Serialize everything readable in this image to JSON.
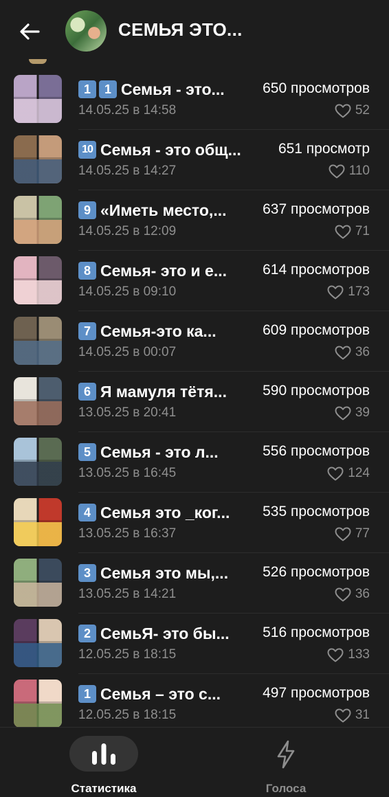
{
  "header": {
    "title": "СЕМЬЯ ЭТО...",
    "back_icon": "arrow-left-icon"
  },
  "posts": [
    {
      "badge": "1 1",
      "badges": [
        "1",
        "1"
      ],
      "title": "Семья - это...",
      "views": "650 просмотров",
      "date": "14.05.25 в 14:58",
      "likes": "52",
      "thumb": [
        "#b9a4c6",
        "#7a6e96",
        "#d8c5d9"
      ]
    },
    {
      "badges": [
        "10"
      ],
      "title": "Семья - это общ...",
      "views": "651 просмотр",
      "date": "14.05.25 в 14:27",
      "likes": "110",
      "thumb": [
        "#8a6b4e",
        "#c49b7a",
        "#3f5a7a"
      ]
    },
    {
      "badges": [
        "9"
      ],
      "title": "«Иметь место,...",
      "views": "637 просмотров",
      "date": "14.05.25 в 12:09",
      "likes": "71",
      "thumb": [
        "#c9c2a5",
        "#7ea374",
        "#d4a07a"
      ]
    },
    {
      "badges": [
        "8"
      ],
      "title": "Семья- это и е...",
      "views": "614 просмотров",
      "date": "14.05.25 в 09:10",
      "likes": "173",
      "thumb": [
        "#e2b4c0",
        "#6c5a6a",
        "#f1d6d8"
      ]
    },
    {
      "badges": [
        "7"
      ],
      "title": "Семья-это ка...",
      "views": "609 просмотров",
      "date": "14.05.25 в 00:07",
      "likes": "36",
      "thumb": [
        "#6e6150",
        "#9a8c74",
        "#4f6a86"
      ]
    },
    {
      "badges": [
        "6"
      ],
      "title": "Я мамуля тётя...",
      "views": "590 просмотров",
      "date": "13.05.25 в 20:41",
      "likes": "39",
      "thumb": [
        "#e8e4dc",
        "#4d5d6e",
        "#9a6b58"
      ]
    },
    {
      "badges": [
        "5"
      ],
      "title": "Семья - это л...",
      "views": "556 просмотров",
      "date": "13.05.25 в 16:45",
      "likes": "124",
      "thumb": [
        "#a9c3d9",
        "#5a6b52",
        "#2e3a4a"
      ]
    },
    {
      "badges": [
        "4"
      ],
      "title": "Семья это _ког...",
      "views": "535 просмотров",
      "date": "13.05.25 в 16:37",
      "likes": "77",
      "thumb": [
        "#e7d7b9",
        "#c0392b",
        "#f2c94c"
      ]
    },
    {
      "badges": [
        "3"
      ],
      "title": "Семья это мы,...",
      "views": "526 просмотров",
      "date": "13.05.25 в 14:21",
      "likes": "36",
      "thumb": [
        "#8fae7d",
        "#3b4a5c",
        "#c7b29a"
      ]
    },
    {
      "badges": [
        "2"
      ],
      "title": "СемьЯ- это бы...",
      "views": "516 просмотров",
      "date": "12.05.25 в 18:15",
      "likes": "133",
      "thumb": [
        "#5a3c5e",
        "#d9c6b0",
        "#2f5b86"
      ]
    },
    {
      "badges": [
        "1"
      ],
      "title": "Семья – это с...",
      "views": "497 просмотров",
      "date": "12.05.25 в 18:15",
      "likes": "31",
      "thumb": [
        "#c96a7a",
        "#f0d9c8",
        "#6d8a4e"
      ]
    }
  ],
  "bottom_nav": {
    "stats_label": "Статистика",
    "votes_label": "Голоса",
    "stats_icon": "bar-chart-icon",
    "votes_icon": "lightning-icon",
    "active": "Статистика"
  },
  "colors": {
    "background": "#1d1d1d",
    "badge": "#5d8fc7",
    "muted_text": "#8e8e8e",
    "active_pill": "#343434"
  }
}
